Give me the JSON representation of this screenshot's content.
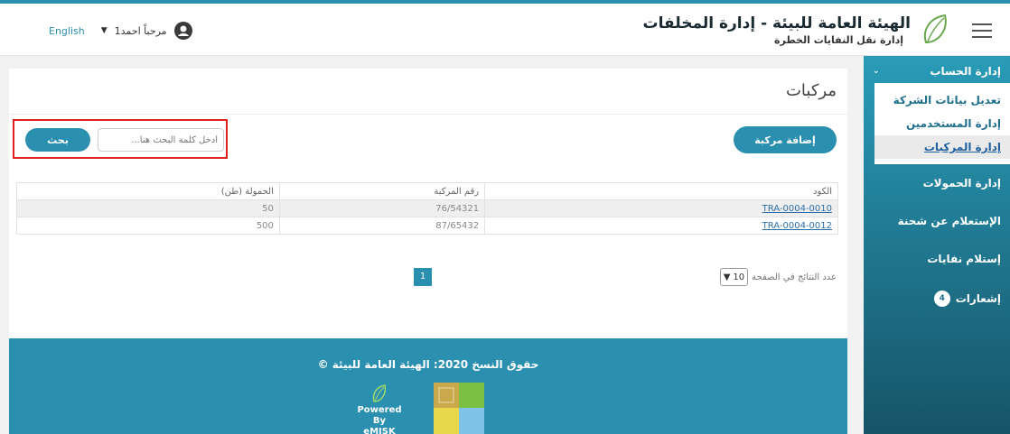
{
  "header": {
    "title": "الهيئة العامة للبيئة - إدارة المخلفات",
    "subtitle": "إدارة نقل النفايات الخطرة",
    "language_link": "English",
    "user_greeting": "مرحباً احمد1"
  },
  "sidebar": {
    "section_label": "إدارة الحساب",
    "submenu": [
      {
        "label": "تعديل بيانات الشركة"
      },
      {
        "label": "إدارة المستخدمين"
      },
      {
        "label": "إدارة المركبات"
      }
    ],
    "items": [
      {
        "label": "إدارة الحمولات"
      },
      {
        "label": "الإستعلام عن شحنة"
      },
      {
        "label": "إستلام نفايات"
      },
      {
        "label": "إشعارات",
        "badge": "4"
      }
    ]
  },
  "main": {
    "page_title": "مركبات",
    "add_button": "إضافة مركبة",
    "search_placeholder": "أدخل كلمة البحث هنا...",
    "search_button": "بحث",
    "table": {
      "columns": [
        "الكود",
        "رقم المركبة",
        "الحمولة (طن)"
      ],
      "rows": [
        {
          "code": "TRA-0004-0010",
          "vehicle_number": "76/54321",
          "load": "50"
        },
        {
          "code": "TRA-0004-0012",
          "vehicle_number": "87/65432",
          "load": "500"
        }
      ]
    },
    "pagination": {
      "current_page": "1",
      "page_size_label": "عدد النتائج في الصفحة",
      "page_size_value": "10"
    }
  },
  "footer": {
    "copyright": "حقوق النسخ 2020: الهيئة العامة للبيئة ©",
    "powered_line1": "Powered By",
    "powered_line2": "eMISK"
  },
  "colors": {
    "accent": "#2b8fb0",
    "highlight_border": "#e02020"
  }
}
